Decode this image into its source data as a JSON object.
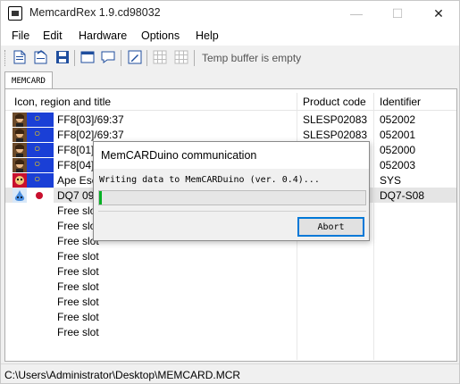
{
  "window": {
    "title": "MemcardRex 1.9.cd98032"
  },
  "menu": [
    "File",
    "Edit",
    "Hardware",
    "Options",
    "Help"
  ],
  "toolbar": {
    "status": "Temp buffer is empty"
  },
  "tab": {
    "label": "MEMCARD"
  },
  "columns": {
    "title": "Icon, region and title",
    "code": "Product code",
    "ident": "Identifier"
  },
  "rows": [
    {
      "title": "FF8[03]/69:37",
      "code": "SLESP02083",
      "ident": "052002",
      "region": "eu",
      "icon": "ff8-squall"
    },
    {
      "title": "FF8[02]/69:37",
      "code": "SLESP02083",
      "ident": "052001",
      "region": "eu",
      "icon": "ff8-squall"
    },
    {
      "title": "FF8[01]/",
      "code": "",
      "ident": "052000",
      "region": "eu",
      "icon": "ff8-squall"
    },
    {
      "title": "FF8[04]/",
      "code": "",
      "ident": "052003",
      "region": "eu",
      "icon": "ff8-squall"
    },
    {
      "title": "Ape Esc",
      "code": "",
      "ident": "SYS",
      "region": "eu",
      "icon": "ape-escape"
    },
    {
      "title": "DQ7 09:",
      "code": "",
      "ident": "DQ7-S08",
      "region": "jp",
      "icon": "slime"
    },
    {
      "title": "Free slot",
      "code": "",
      "ident": "",
      "region": "",
      "icon": ""
    },
    {
      "title": "Free slot",
      "code": "",
      "ident": "",
      "region": "",
      "icon": ""
    },
    {
      "title": "Free slot",
      "code": "",
      "ident": "",
      "region": "",
      "icon": ""
    },
    {
      "title": "Free slot",
      "code": "",
      "ident": "",
      "region": "",
      "icon": ""
    },
    {
      "title": "Free slot",
      "code": "",
      "ident": "",
      "region": "",
      "icon": ""
    },
    {
      "title": "Free slot",
      "code": "",
      "ident": "",
      "region": "",
      "icon": ""
    },
    {
      "title": "Free slot",
      "code": "",
      "ident": "",
      "region": "",
      "icon": ""
    },
    {
      "title": "Free slot",
      "code": "",
      "ident": "",
      "region": "",
      "icon": ""
    },
    {
      "title": "Free slot",
      "code": "",
      "ident": "",
      "region": "",
      "icon": ""
    }
  ],
  "statusbar": {
    "path": "C:\\Users\\Administrator\\Desktop\\MEMCARD.MCR"
  },
  "dialog": {
    "title": "MemCARDuino communication",
    "message": "Writing data to MemCARDuino (ver. 0.4)...",
    "progress": 0.01,
    "abort_label": "Abort"
  },
  "colors": {
    "accent": "#0078d7",
    "progress": "#06b025",
    "flag_eu": "#1a3fd6",
    "selected_row": "#e5e5e5"
  }
}
